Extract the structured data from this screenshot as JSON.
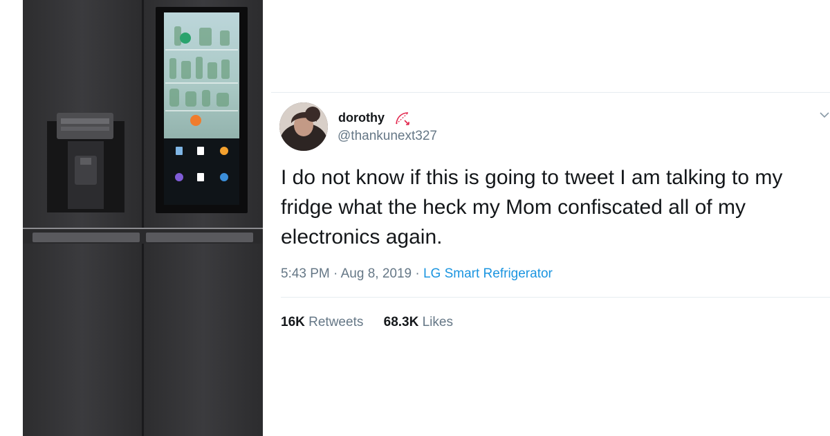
{
  "tweet": {
    "display_name": "dorothy",
    "display_name_icon": "bow-and-arrow-icon",
    "handle": "@thankunext327",
    "text": "I do not know if this is going to tweet I am talking to my fridge what the heck my Mom confiscated all of my electronics again.",
    "time": "5:43 PM",
    "separator": "·",
    "date": "Aug 8, 2019",
    "source": "LG Smart Refrigerator",
    "retweets_count": "16K",
    "retweets_label": "Retweets",
    "likes_count": "68.3K",
    "likes_label": "Likes",
    "menu_icon": "chevron-down-icon"
  },
  "image": {
    "subject": "fridge-image",
    "screen_icons": [
      "app-icon",
      "app-icon",
      "app-icon",
      "app-icon",
      "app-icon",
      "app-icon"
    ]
  },
  "colors": {
    "link": "#1b95e0",
    "text": "#14171a",
    "secondary": "#657786",
    "divider": "#e6ecf0",
    "bow_icon": "#e2264d"
  }
}
